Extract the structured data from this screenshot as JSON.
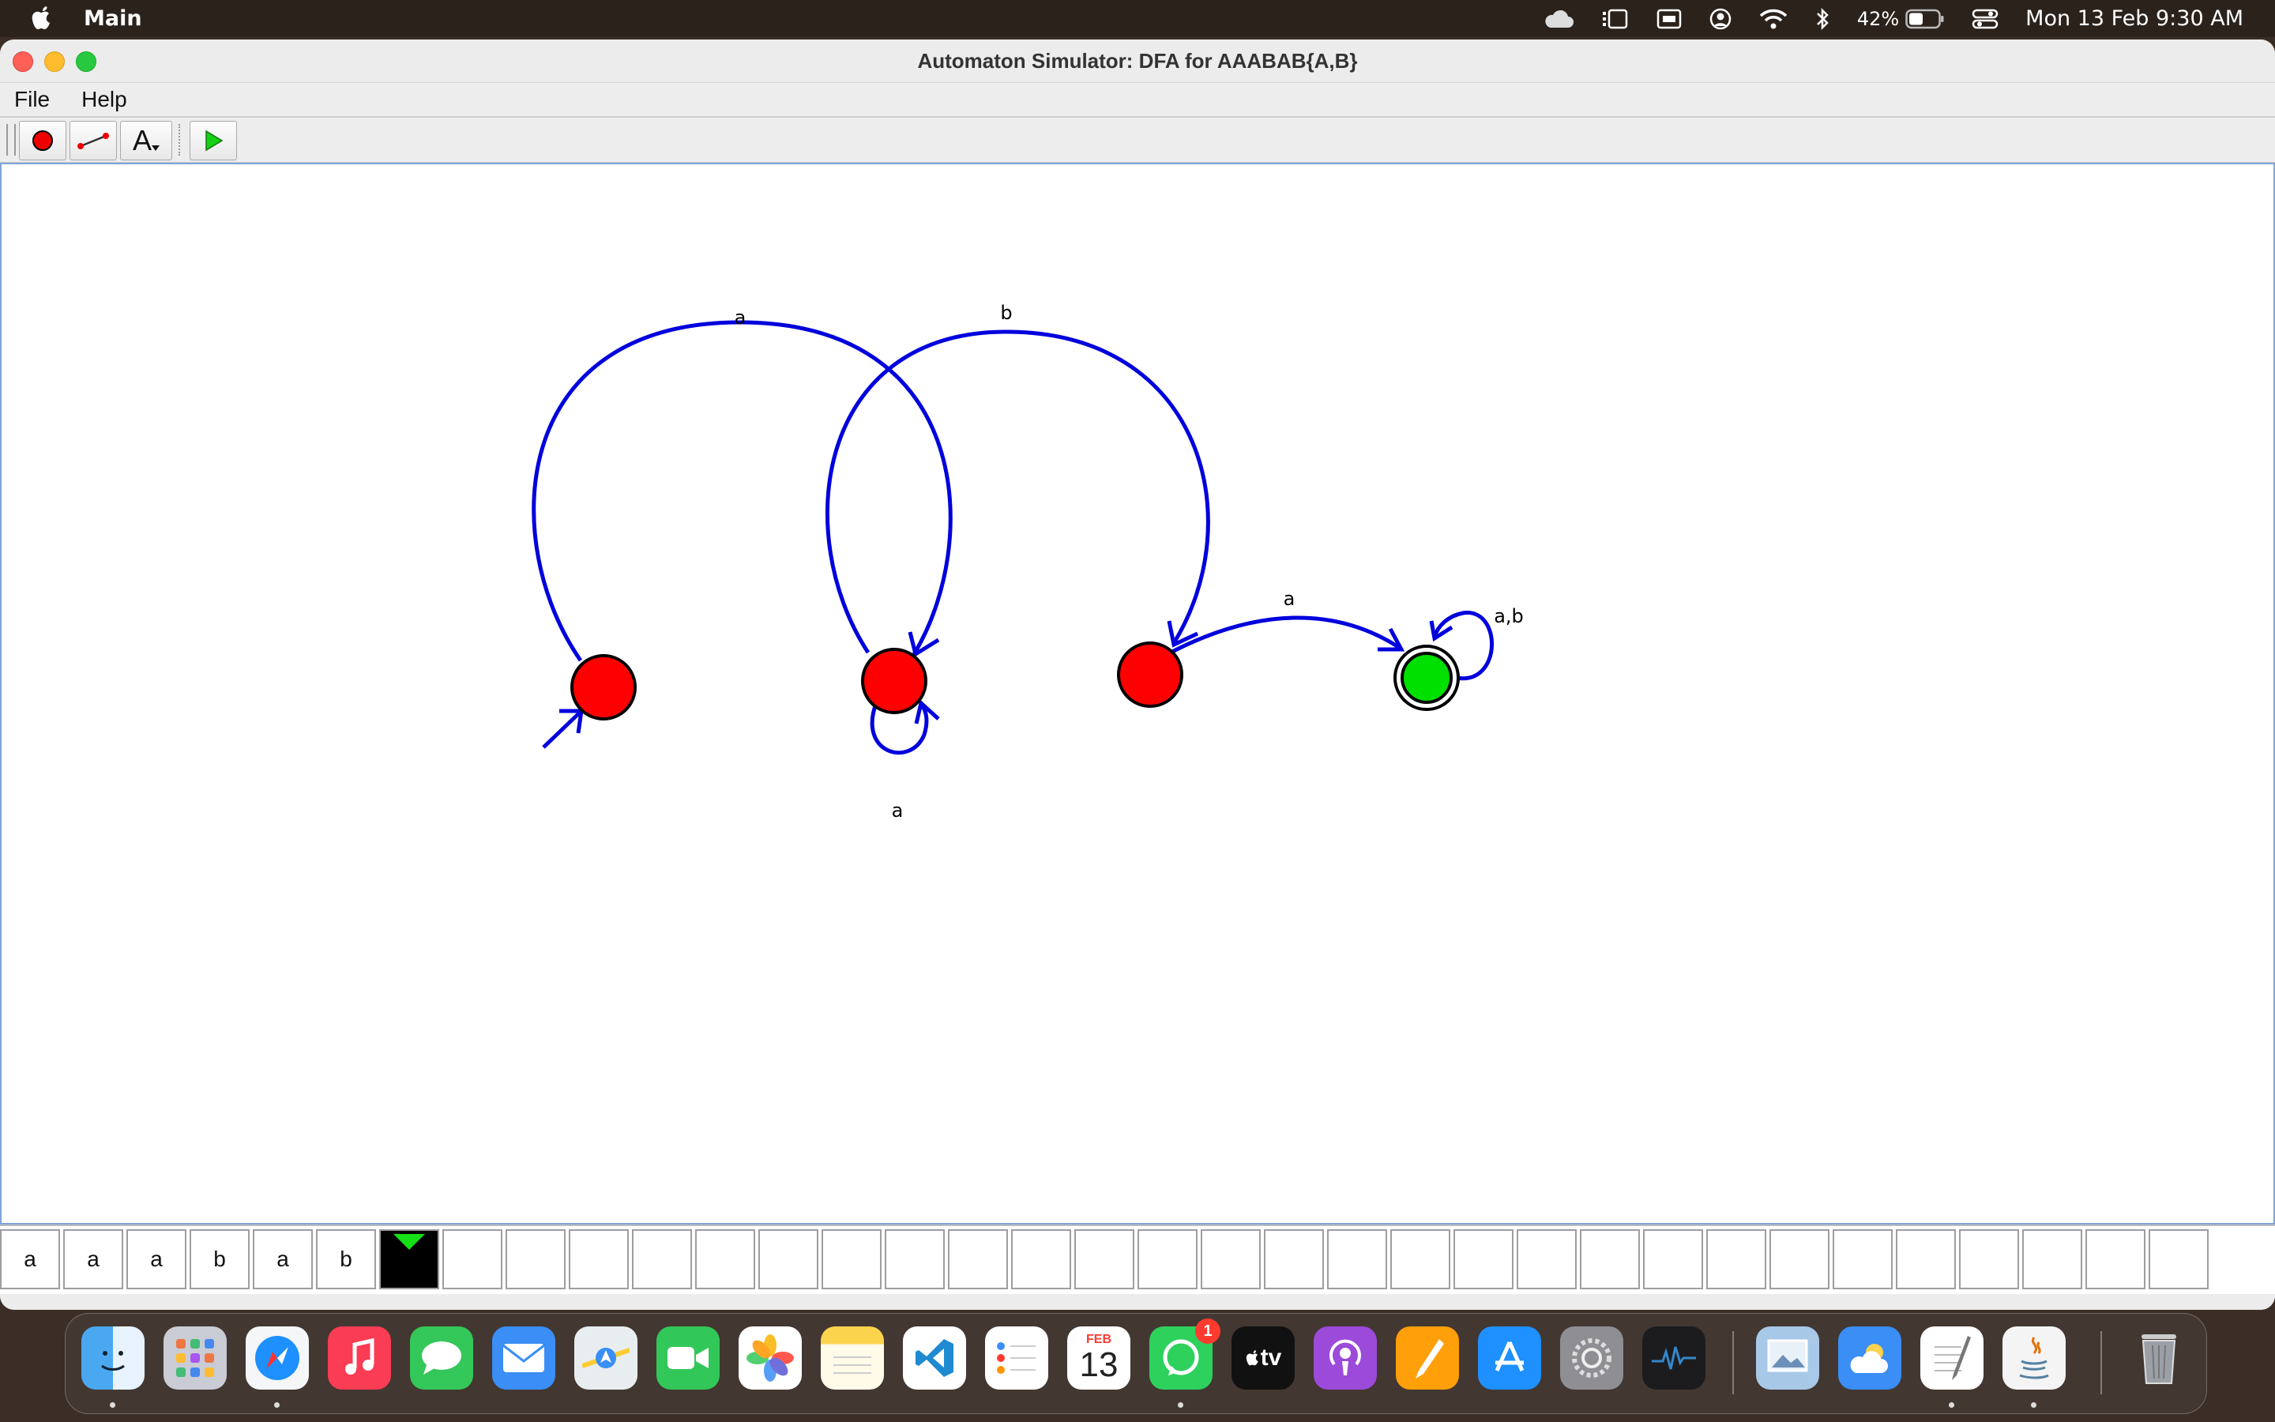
{
  "menubar": {
    "app_name": "Main",
    "battery_percent": "42%",
    "clock": "Mon 13 Feb  9:30 AM",
    "icons": [
      "apple-icon",
      "icloud-icon",
      "stage-manager-icon",
      "screen-mirror-icon",
      "user-icon",
      "wifi-icon",
      "bluetooth-icon",
      "battery-icon",
      "control-center-icon"
    ]
  },
  "window": {
    "title": "Automaton Simulator: DFA for AAABAB{A,B}",
    "menu": [
      "File",
      "Help"
    ],
    "toolbar": [
      "add-state-tool",
      "add-transition-tool",
      "add-label-tool",
      "run-button"
    ],
    "toolbar_label_glyph": "A"
  },
  "automaton": {
    "states": [
      {
        "id": "q0",
        "initial": true,
        "accepting": false,
        "active": false
      },
      {
        "id": "q1",
        "initial": false,
        "accepting": false,
        "active": false
      },
      {
        "id": "q2",
        "initial": false,
        "accepting": false,
        "active": false
      },
      {
        "id": "q3",
        "initial": false,
        "accepting": true,
        "active": true
      }
    ],
    "transitions": [
      {
        "from": "q0",
        "to": "q1",
        "label": "a"
      },
      {
        "from": "q1",
        "to": "q1",
        "label": "a"
      },
      {
        "from": "q1",
        "to": "q2",
        "label": "b"
      },
      {
        "from": "q2",
        "to": "q3",
        "label": "a"
      },
      {
        "from": "q3",
        "to": "q3",
        "label": "a,b"
      }
    ],
    "colors": {
      "state": "#ff0000",
      "active_state": "#00e000",
      "edge": "#0000dd"
    }
  },
  "tape": {
    "symbols": [
      "a",
      "a",
      "a",
      "b",
      "a",
      "b"
    ],
    "head_index": 6,
    "total_cells": 35
  },
  "dock": {
    "apps": [
      "Finder",
      "Launchpad",
      "Safari",
      "Music",
      "Messages",
      "Mail",
      "Maps",
      "FaceTime",
      "Photos",
      "Notes",
      "Visual Studio Code",
      "Reminders",
      "Calendar",
      "WhatsApp",
      "TV",
      "Podcasts",
      "Pages",
      "App Store",
      "System Settings",
      "Activity Monitor",
      "Preview",
      "Weather",
      "TextEdit",
      "Java",
      "Trash"
    ],
    "calendar_month": "FEB",
    "calendar_day": "13",
    "whatsapp_badge": "1",
    "tv_label": "tv"
  }
}
